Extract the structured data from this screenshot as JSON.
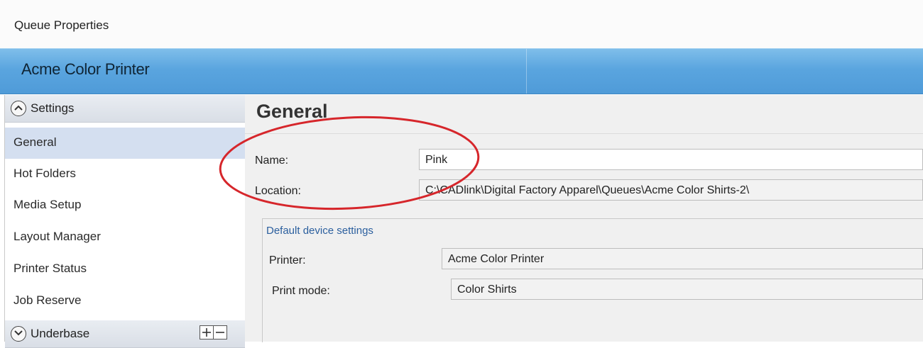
{
  "window": {
    "title": "Queue Properties"
  },
  "banner": {
    "queue_name": "Acme Color Printer"
  },
  "sidebar": {
    "settings_group": "Settings",
    "items": [
      {
        "label": "General",
        "selected": true
      },
      {
        "label": "Hot Folders"
      },
      {
        "label": "Media Setup"
      },
      {
        "label": "Layout Manager"
      },
      {
        "label": "Printer Status"
      },
      {
        "label": "Job Reserve"
      }
    ],
    "underbase_group": "Underbase"
  },
  "general": {
    "title": "General",
    "name_label": "Name:",
    "name_value": "Pink",
    "location_label": "Location:",
    "location_value": "C:\\CADlink\\Digital Factory Apparel\\Queues\\Acme Color Shirts-2\\",
    "device_settings_title": "Default device settings",
    "printer_label": "Printer:",
    "printer_value": "Acme Color Printer",
    "print_mode_label": "Print mode:",
    "print_mode_value": "Color Shirts"
  },
  "colors": {
    "banner": "#5aa5df",
    "selected_item": "#d4dff0",
    "annotation_oval": "#d6262b"
  }
}
